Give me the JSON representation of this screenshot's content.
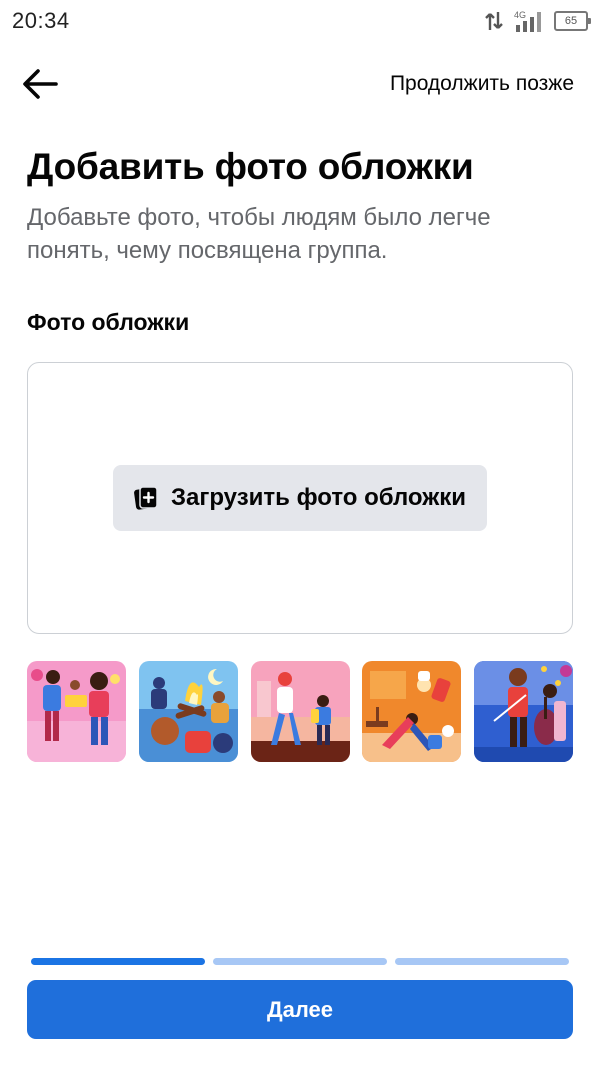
{
  "status_bar": {
    "time": "20:34",
    "network": "4G",
    "battery": "65"
  },
  "header": {
    "back_icon": "arrow-left-icon",
    "later_label": "Продолжить позже"
  },
  "page": {
    "title": "Добавить фото обложки",
    "subtitle": "Добавьте фото, чтобы людям было легче понять, чему посвящена группа.",
    "section_label": "Фото обложки"
  },
  "upload": {
    "icon": "photo-add-icon",
    "label": "Загрузить фото обложки"
  },
  "thumbnails": [
    {
      "name": "cover-illustration-friends"
    },
    {
      "name": "cover-illustration-campfire"
    },
    {
      "name": "cover-illustration-walking"
    },
    {
      "name": "cover-illustration-yoga"
    },
    {
      "name": "cover-illustration-music"
    }
  ],
  "progress": {
    "steps_total": 3,
    "current_step": 1
  },
  "footer": {
    "next_label": "Далее"
  },
  "colors": {
    "primary": "#1f6fdb",
    "progress_active": "#1b74e4",
    "progress_inactive": "#a7c7f5",
    "secondary_text": "#65676b",
    "button_gray": "#e4e6eb"
  }
}
